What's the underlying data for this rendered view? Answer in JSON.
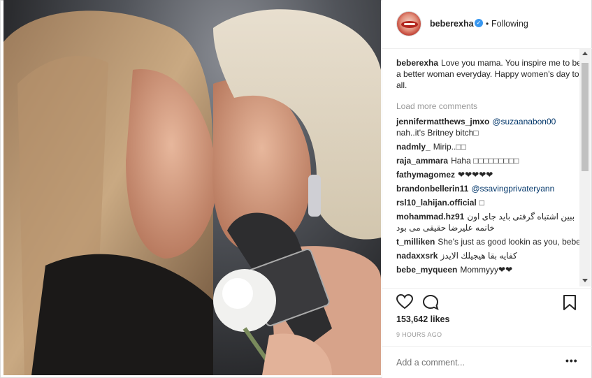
{
  "header": {
    "username": "beberexha",
    "verified_icon": "verified-badge-icon",
    "separator": "•",
    "follow_status": "Following"
  },
  "caption": {
    "username": "beberexha",
    "text": "Love you mama. You inspire me to be a better woman everyday. Happy women's day to all."
  },
  "load_more": "Load more comments",
  "comments": [
    {
      "username": "jennifermatthews_jmxo",
      "mention": "@suzaanabon00",
      "text": "nah..it's Britney bitch□"
    },
    {
      "username": "nadmly_",
      "mention": "",
      "text": "Mirip..□□"
    },
    {
      "username": "raja_ammara",
      "mention": "",
      "text": "Haha □□□□□□□□□"
    },
    {
      "username": "fathymagomez",
      "mention": "",
      "text": "❤❤❤❤❤"
    },
    {
      "username": "brandonbellerin11",
      "mention": "@ssavingprivateryann",
      "text": ""
    },
    {
      "username": "rsl10_lahijan.official",
      "mention": "",
      "text": "□"
    },
    {
      "username": "mohammad.hz91",
      "mention": "",
      "text": "ببین اشتباه گرفتی باید جای اون خانمه علیرضا حقیقی می بود"
    },
    {
      "username": "t_milliken",
      "mention": "",
      "text": "She's just as good lookin as you, bebe"
    },
    {
      "username": "nadaxxsrk",
      "mention": "",
      "text": "كفايه بقا هيجيلك الايدز"
    },
    {
      "username": "bebe_myqueen",
      "mention": "",
      "text": "Mommyyy❤❤"
    }
  ],
  "likes": "153,642 likes",
  "time": "9 HOURS AGO",
  "add_comment_placeholder": "Add a comment...",
  "more_options": "•••",
  "colors": {
    "link": "#003569",
    "verified": "#3897f0",
    "muted": "#999999"
  }
}
